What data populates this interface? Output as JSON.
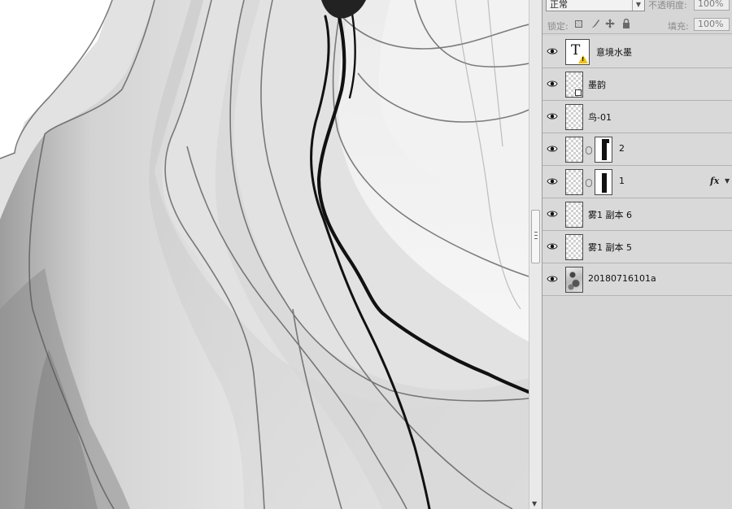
{
  "panel": {
    "blend_mode": "正常",
    "opacity_label": "不透明度:",
    "opacity_value": "100%",
    "lock_label": "锁定:",
    "fill_label": "填充:",
    "fill_value": "100%",
    "icons": {
      "lock_transparent": "checker-square-icon",
      "lock_pixels": "brush-icon",
      "lock_position": "move-icon",
      "lock_all": "padlock-icon",
      "visibility": "eye-icon"
    }
  },
  "layers": [
    {
      "name": "意境水墨",
      "kind": "text",
      "warning": true
    },
    {
      "name": "墨韵",
      "kind": "smart-object"
    },
    {
      "name": "鸟-01",
      "kind": "pixel"
    },
    {
      "name": "2",
      "kind": "pixel-with-mask"
    },
    {
      "name": "1",
      "kind": "pixel-with-mask",
      "fx": "fx"
    },
    {
      "name": "雾1 副本 6",
      "kind": "pixel"
    },
    {
      "name": "雾1 副本 5",
      "kind": "pixel"
    },
    {
      "name": "20180716101a",
      "kind": "image"
    }
  ],
  "colors": {
    "panel_bg": "#d6d6d6",
    "canvas_bg": "#ffffff",
    "ink": "#111111"
  }
}
